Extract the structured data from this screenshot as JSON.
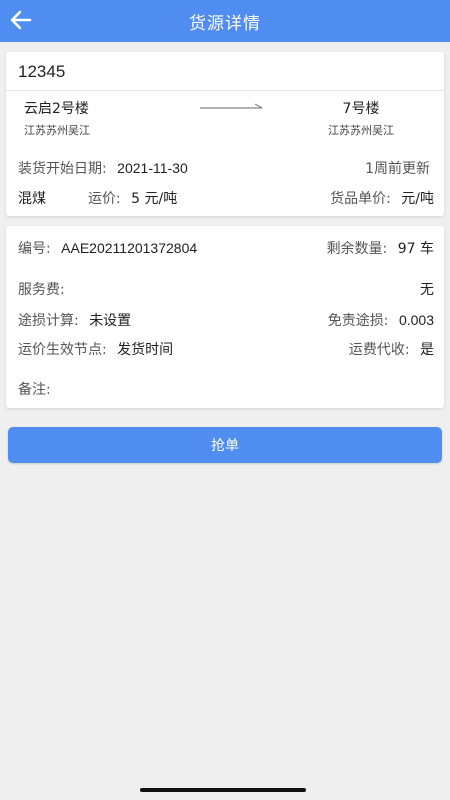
{
  "header": {
    "title": "货源详情"
  },
  "cargo": {
    "code": "12345",
    "origin": {
      "name": "云启2号楼",
      "region": "江苏苏州吴江"
    },
    "destination": {
      "name": "7号楼",
      "region": "江苏苏州吴江"
    },
    "load_date_label": "装货开始日期:",
    "load_date": "2021-11-30",
    "updated": "1周前更新",
    "goods": "混煤",
    "freight_label": "运价:",
    "freight": "5 元/吨",
    "unit_price_label": "货品单价:",
    "unit_price": "元/吨"
  },
  "details": {
    "number_label": "编号:",
    "number": "AAE20211201372804",
    "remaining_label": "剩余数量:",
    "remaining": "97 车",
    "service_fee_label": "服务费:",
    "service_fee": "无",
    "loss_calc_label": "途损计算:",
    "loss_calc": "未设置",
    "exempt_loss_label": "免责途损:",
    "exempt_loss": "0.003",
    "effective_node_label": "运价生效节点:",
    "effective_node": "发货时间",
    "collection_label": "运费代收:",
    "collection": "是",
    "remark_label": "备注:"
  },
  "actions": {
    "grab_label": "抢单"
  },
  "colors": {
    "primary": "#4f8df0",
    "background": "#efefef"
  }
}
